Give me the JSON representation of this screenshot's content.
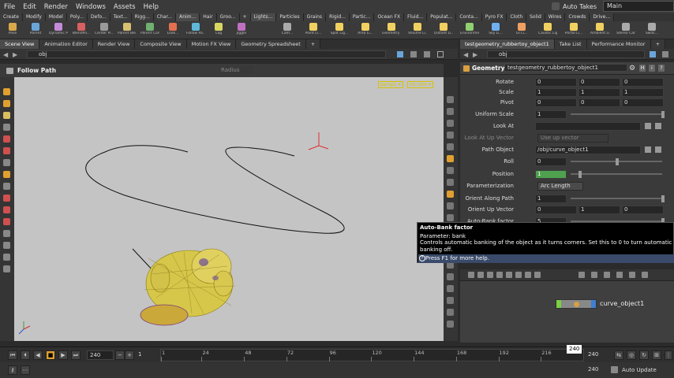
{
  "menu": [
    "File",
    "Edit",
    "Render",
    "Windows",
    "Assets",
    "Help"
  ],
  "takes_label": "Auto Takes",
  "desktop": "Main",
  "shelf_tabs_left": [
    "Create",
    "Modify",
    "Model",
    "Poly...",
    "Defo...",
    "Text...",
    "Rigg...",
    "Char...",
    "Anim...",
    "Hair",
    "Groo..."
  ],
  "shelf_tabs_right": [
    "Lights...",
    "Particles",
    "Grains",
    "Rigid...",
    "Partic...",
    "Ocean FX",
    "Fluid...",
    "Populat...",
    "Conta...",
    "Pyro FX",
    "Cloth",
    "Solid",
    "Wires",
    "Crowds",
    "Drive..."
  ],
  "shelf_tools_left": [
    {
      "label": "Pose",
      "color": "#d8a84a"
    },
    {
      "label": "Parent",
      "color": "#6aa5d9"
    },
    {
      "label": "Dynamic Pa...",
      "color": "#c58ad8"
    },
    {
      "label": "BlendPo...",
      "color": "#d86060"
    },
    {
      "label": "Center Pi...",
      "color": "#9a9a9a"
    },
    {
      "label": "Parent Ble...",
      "color": "#d8c070"
    },
    {
      "label": "Parent Con...",
      "color": "#70b070"
    },
    {
      "label": "Look...",
      "color": "#e07050"
    },
    {
      "label": "Follow Pa...",
      "color": "#5fb8d8"
    },
    {
      "label": "Lag",
      "color": "#d8d860"
    },
    {
      "label": "Jiggle",
      "color": "#c070c0"
    }
  ],
  "shelf_tools_right": [
    {
      "label": "Cam...",
      "color": "#aaaaaa"
    },
    {
      "label": "Point Li...",
      "color": "#f0d060"
    },
    {
      "label": "Spot Lig...",
      "color": "#f0d060"
    },
    {
      "label": "Area Li...",
      "color": "#f0d060"
    },
    {
      "label": "Geometry L...",
      "color": "#f0d060"
    },
    {
      "label": "Volume Li...",
      "color": "#f0d060"
    },
    {
      "label": "Distant Li...",
      "color": "#f0d060"
    },
    {
      "label": "Environme...",
      "color": "#8fd070"
    },
    {
      "label": "Sky Li...",
      "color": "#70b0f0"
    },
    {
      "label": "GI Li...",
      "color": "#f0a060"
    },
    {
      "label": "Caustic Lig...",
      "color": "#f0d060"
    },
    {
      "label": "Portal Li...",
      "color": "#f0d060"
    },
    {
      "label": "Ambient Li...",
      "color": "#f0d060"
    },
    {
      "label": "Stereo Cam...",
      "color": "#aaaaaa"
    },
    {
      "label": "Switc...",
      "color": "#aaaaaa"
    }
  ],
  "pane_tabs_left": [
    "Scene View",
    "Animation Editor",
    "Render View",
    "Composite View",
    "Motion FX View",
    "Geometry Spreadsheet"
  ],
  "pane_tabs_right": [
    "testgeometry_rubbertoy_object1",
    "Take List",
    "Performance Monitor"
  ],
  "left_path": "obj",
  "right_path": "obj",
  "viewport": {
    "tool_title": "Follow Path",
    "radius_label": "Radius",
    "cam_persp": "persp1",
    "cam_nocam": "no cam",
    "bg": "#c4c4c4"
  },
  "params": {
    "node_type": "Geometry",
    "node_name": "testgeometry_rubbertoy_object1",
    "rows": [
      {
        "label": "Rotate",
        "values": [
          "0",
          "0",
          "0"
        ]
      },
      {
        "label": "Scale",
        "values": [
          "1",
          "1",
          "1"
        ]
      },
      {
        "label": "Pivot",
        "values": [
          "0",
          "0",
          "0"
        ]
      },
      {
        "label": "Uniform Scale",
        "value": "1"
      },
      {
        "label": "Look At",
        "value": ""
      },
      {
        "label": "Look At Up Vector",
        "value": "Use up vector"
      },
      {
        "label": "Path Object",
        "value": "/obj/curve_object1"
      },
      {
        "label": "Roll",
        "value": "0"
      },
      {
        "label": "Position",
        "value": "1"
      },
      {
        "label": "Parameterization",
        "value": "Arc Length"
      },
      {
        "label": "Orient Along Path",
        "value": "1"
      },
      {
        "label": "Orient Up Vector",
        "values": [
          "0",
          "1",
          "0"
        ]
      },
      {
        "label": "Auto-Bank factor",
        "value": "5"
      }
    ]
  },
  "tooltip": {
    "title": "Auto-Bank factor",
    "param": "Parameter: bank",
    "line1": "Controls automatic banking of the object as it turns corners. Set this to 0 to turn automatic",
    "line2": "banking off.",
    "help": "Press F1 for more help."
  },
  "network": {
    "node_label": "curve_object1"
  },
  "timeline": {
    "frame": "240",
    "step": "1",
    "ticks": [
      "1",
      "24",
      "48",
      "72",
      "96",
      "120",
      "144",
      "168",
      "192",
      "216"
    ],
    "current": "240",
    "end1": "240",
    "end2": "240",
    "update": "Auto Update"
  }
}
